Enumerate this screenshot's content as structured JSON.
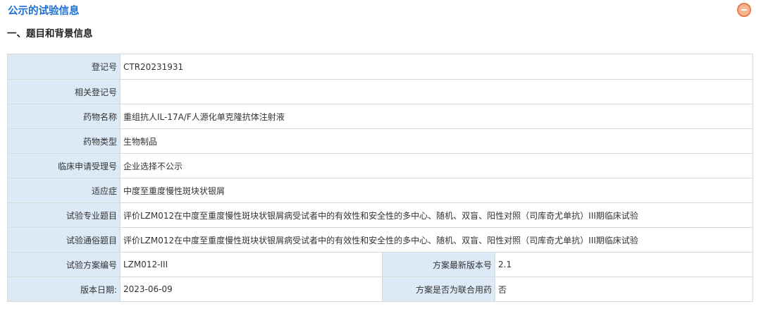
{
  "header": {
    "title": "公示的试验信息",
    "collapse_icon": "minus-circle-icon"
  },
  "section": {
    "title": "一、题目和背景信息"
  },
  "colors": {
    "title_blue": "#1a6fd6",
    "label_bg": "#dce9f7",
    "border": "#d9d9d9",
    "collapse_orange": "#ee7a4a"
  },
  "rows": {
    "reg_no": {
      "label": "登记号",
      "value": "CTR20231931"
    },
    "related_reg_no": {
      "label": "相关登记号",
      "value": ""
    },
    "drug_name": {
      "label": "药物名称",
      "value": "重组抗人IL-17A/F人源化单克隆抗体注射液"
    },
    "drug_type": {
      "label": "药物类型",
      "value": "生物制品"
    },
    "clinical_app_no": {
      "label": "临床申请受理号",
      "value": "企业选择不公示"
    },
    "indication": {
      "label": "适应症",
      "value": "中度至重度慢性斑块状银屑"
    },
    "professional_title": {
      "label": "试验专业题目",
      "value": "评价LZM012在中度至重度慢性斑块状银屑病受试者中的有效性和安全性的多中心、随机、双盲、阳性对照（司库奇尤单抗）III期临床试验"
    },
    "popular_title": {
      "label": "试验通俗题目",
      "value": "评价LZM012在中度至重度慢性斑块状银屑病受试者中的有效性和安全性的多中心、随机、双盲、阳性对照（司库奇尤单抗）III期临床试验"
    },
    "protocol_no": {
      "label": "试验方案编号",
      "value": "LZM012-III"
    },
    "latest_version": {
      "label": "方案最新版本号",
      "value": "2.1"
    },
    "version_date": {
      "label": "版本日期:",
      "value": "2023-06-09"
    },
    "combination": {
      "label": "方案是否为联合用药",
      "value": "否"
    }
  }
}
